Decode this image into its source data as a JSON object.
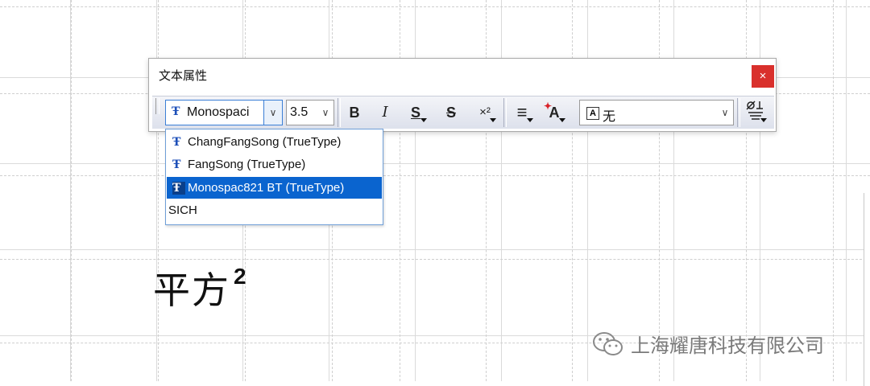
{
  "dialog": {
    "title": "文本属性",
    "close_label": "×",
    "font_combo": {
      "value": "Monospaci"
    },
    "size_combo": {
      "value": "3.5"
    },
    "buttons": {
      "bold": "B",
      "italic": "I",
      "underline": "S",
      "strike": "S",
      "superscript": "×²",
      "align": "≡",
      "color": "A"
    },
    "frame_combo": {
      "icon_text": "A",
      "value": "无"
    }
  },
  "font_dropdown": {
    "items": [
      {
        "label": "ChangFangSong (TrueType)",
        "icon": "truetype-icon"
      },
      {
        "label": "FangSong (TrueType)",
        "icon": "truetype-icon"
      },
      {
        "label": "Monospac821 BT (TrueType)",
        "icon": "truetype-icon",
        "selected": true
      },
      {
        "label": "SICH",
        "icon": ""
      }
    ]
  },
  "canvas": {
    "sample_text": "平方",
    "sample_superscript": "2"
  },
  "watermark": {
    "text": "上海耀唐科技有限公司",
    "icon": "wechat-icon"
  },
  "colors": {
    "close_button": "#d9302c",
    "selection": "#0a64cf",
    "truetype_icon": "#1d4fb8"
  }
}
